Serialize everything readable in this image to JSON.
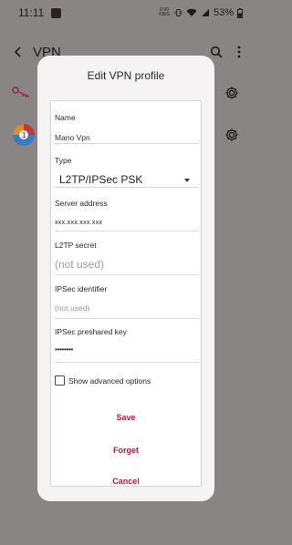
{
  "status_bar": {
    "time": "11:11",
    "net_speed_top": "0.00",
    "net_speed_bottom": "KB/S",
    "battery": "53%"
  },
  "app_bar": {
    "title": "VPN",
    "icons": [
      "back-arrow-icon",
      "search-icon",
      "more-vert-icon"
    ]
  },
  "background_list": {
    "items": [
      {
        "icon": "key-icon",
        "action_icon": "gear-icon"
      },
      {
        "icon": "mano-vpn-app-icon",
        "action_icon": "gear-icon"
      }
    ]
  },
  "dialog": {
    "title": "Edit VPN profile",
    "fields": {
      "name": {
        "label": "Name",
        "value": "Mano Vpn"
      },
      "type": {
        "label": "Type",
        "value": "L2TP/IPSec PSK"
      },
      "server_address": {
        "label": "Server address",
        "value": "xxx.xxx.xxx.xxx"
      },
      "l2tp_secret": {
        "label": "L2TP secret",
        "placeholder": "(not used)"
      },
      "ipsec_identifier": {
        "label": "IPSec identifier",
        "placeholder": "(not used)"
      },
      "ipsec_preshared_key": {
        "label": "IPSec preshared key",
        "value": "••••••••"
      }
    },
    "show_advanced": {
      "label": "Show advanced options",
      "checked": false
    },
    "save_label": "Save",
    "forget_label": "Forget",
    "cancel_label": "Cancel"
  },
  "colors": {
    "accent": "#a81f47",
    "scrim_background": "#8a8585",
    "dialog_surface": "#f5f3f3"
  }
}
